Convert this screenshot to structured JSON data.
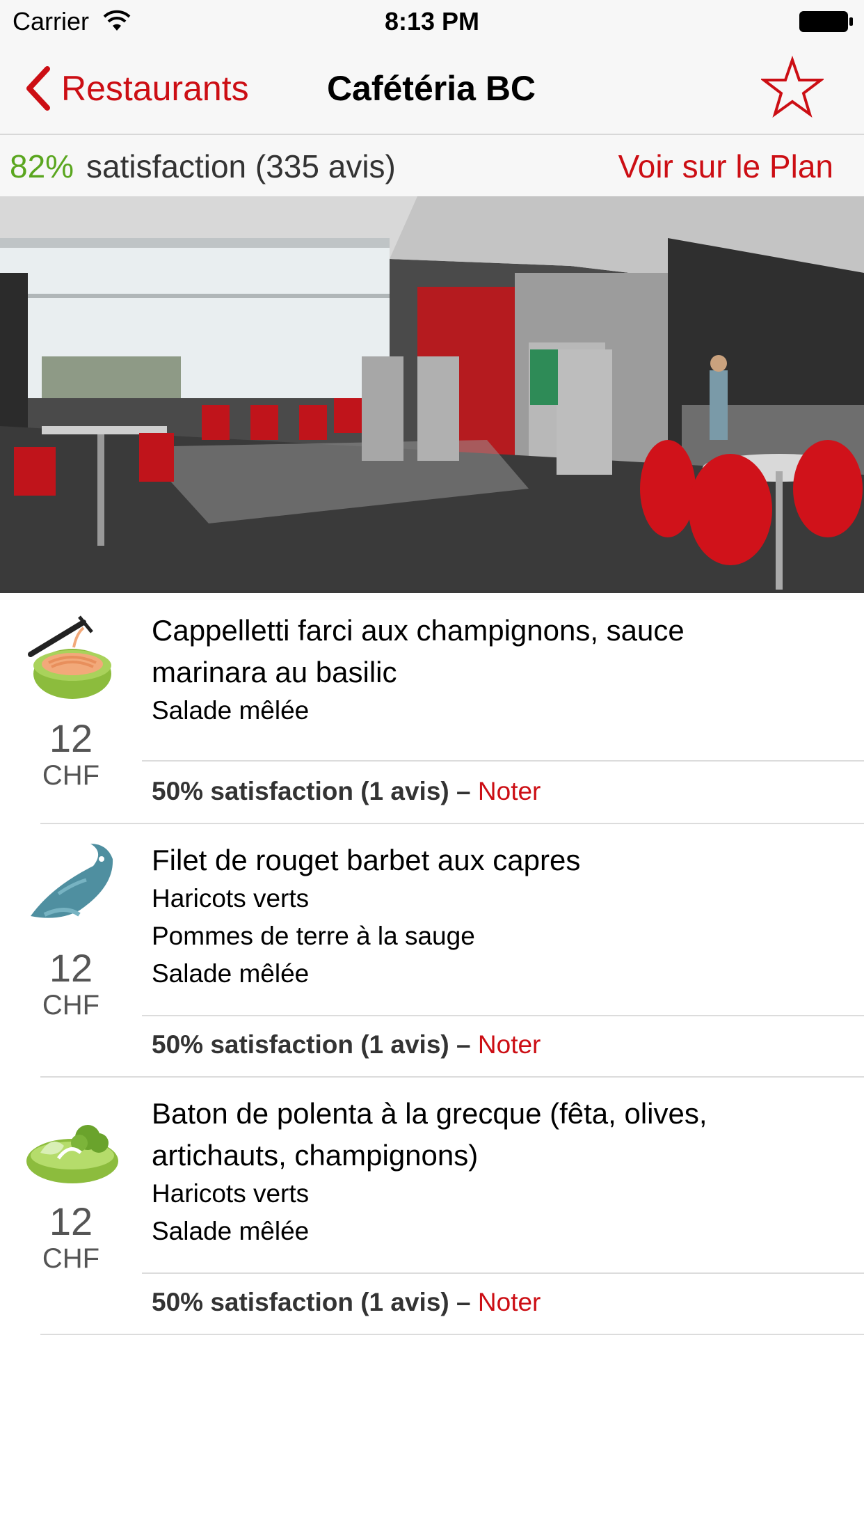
{
  "status": {
    "carrier": "Carrier",
    "time": "8:13 PM"
  },
  "nav": {
    "back_label": "Restaurants",
    "title": "Cafétéria BC",
    "star": "star-icon"
  },
  "summary": {
    "percent": "82%",
    "text": "satisfaction (335 avis)",
    "map_link": "Voir sur le Plan"
  },
  "photo": {
    "subject": "cafeteria-interior-photo"
  },
  "colors": {
    "accent": "#cc0e14",
    "positive": "#5aa61f",
    "bar_bg": "#f7f7f7"
  },
  "menu": [
    {
      "icon": "pasta-icon",
      "title_line1": "Cappelletti farci aux champignons, sauce",
      "title_line2": "marinara au basilic",
      "sides": [
        "Salade mêlée"
      ],
      "price": "12",
      "currency": "CHF",
      "rating": "50% satisfaction (1 avis) –",
      "rate_label": "Noter"
    },
    {
      "icon": "fish-icon",
      "title_line1": "Filet de rouget barbet aux capres",
      "title_line2": "",
      "sides": [
        "Haricots verts",
        "Pommes de terre à la sauge",
        "Salade mêlée"
      ],
      "price": "12",
      "currency": "CHF",
      "rating": "50% satisfaction (1 avis) –",
      "rate_label": "Noter"
    },
    {
      "icon": "salad-icon",
      "title_line1": "Baton de polenta à la grecque (fêta, olives,",
      "title_line2": "artichauts, champignons)",
      "sides": [
        "Haricots verts",
        "Salade mêlée"
      ],
      "price": "12",
      "currency": "CHF",
      "rating": "50% satisfaction (1 avis) –",
      "rate_label": "Noter"
    }
  ]
}
